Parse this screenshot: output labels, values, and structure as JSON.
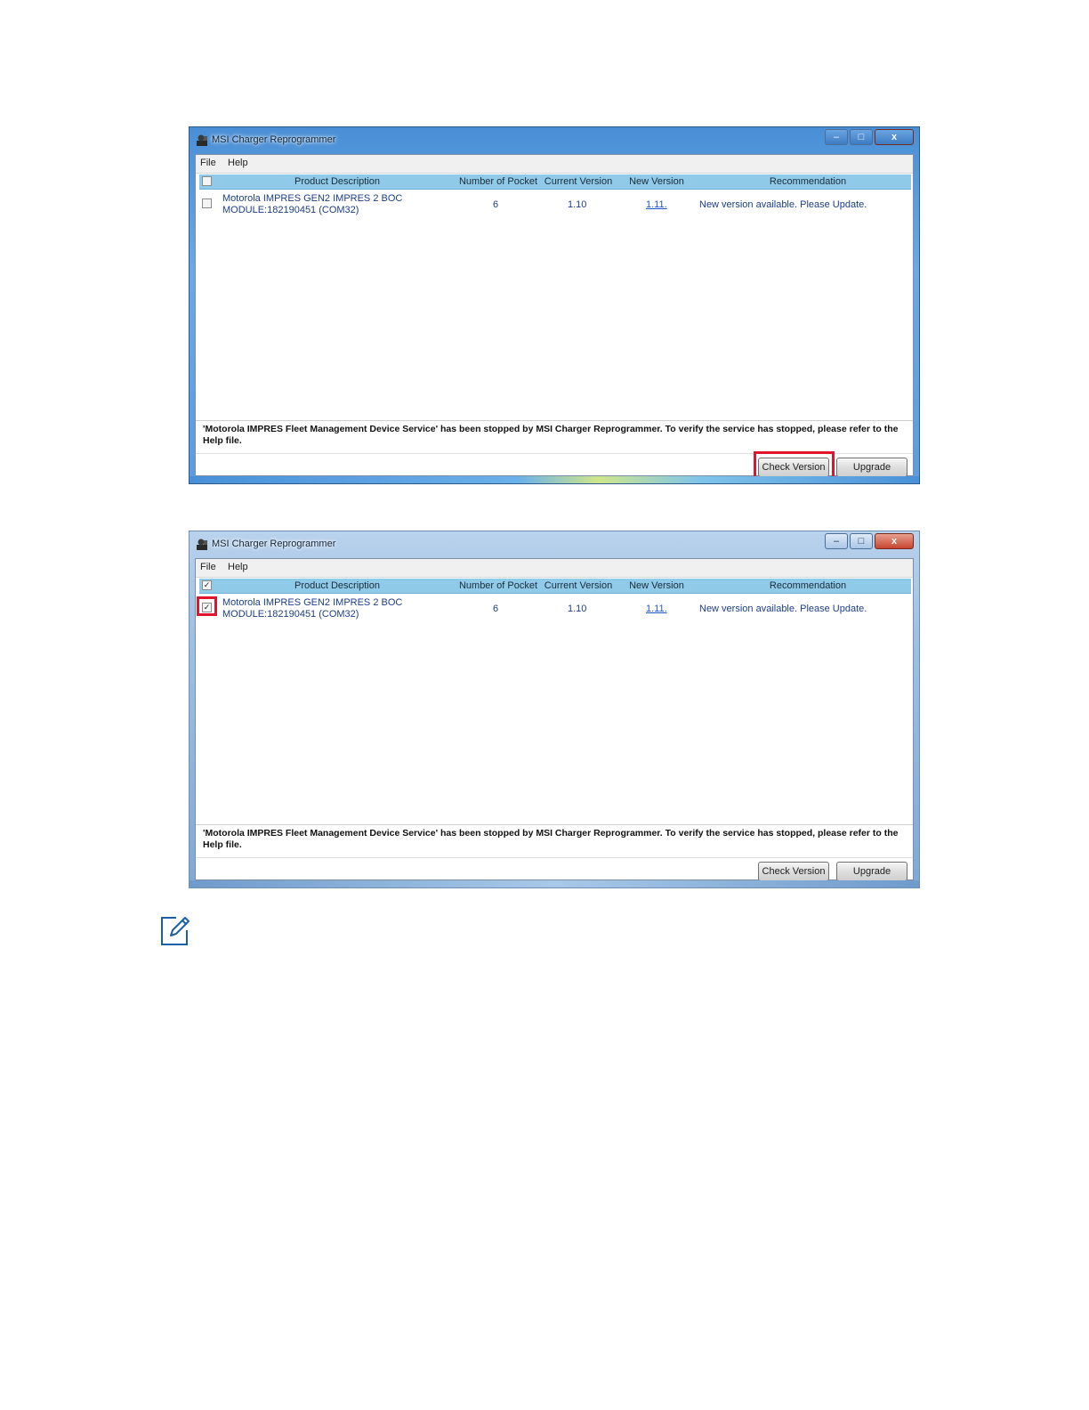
{
  "windows": [
    {
      "title": "MSI Charger Reprogrammer",
      "controls": {
        "minimize": "–",
        "maximize": "□",
        "close": "x"
      },
      "menu": [
        "File",
        "Help"
      ],
      "columns": [
        "Product Description",
        "Number of Pocket",
        "Current Version",
        "New Version",
        "Recommendation"
      ],
      "header_checked": false,
      "row": {
        "checked": false,
        "checkmark": "",
        "description_line1": "Motorola IMPRES GEN2 IMPRES 2 BOC",
        "description_line2": "MODULE:182190451 (COM32)",
        "pockets": "6",
        "current_version": "1.10",
        "new_version": "1.11.",
        "recommendation": "New version available. Please Update."
      },
      "message": "'Motorola IMPRES Fleet Management Device Service' has been stopped by MSI Charger Reprogrammer. To verify the service has stopped, please refer to the Help file.",
      "buttons": {
        "check_version": "Check Version",
        "upgrade": "Upgrade"
      },
      "highlight": "check-version-button"
    },
    {
      "title": "MSI Charger Reprogrammer",
      "controls": {
        "minimize": "–",
        "maximize": "□",
        "close": "x"
      },
      "menu": [
        "File",
        "Help"
      ],
      "columns": [
        "Product Description",
        "Number of Pocket",
        "Current Version",
        "New Version",
        "Recommendation"
      ],
      "header_checked": true,
      "header_checkmark": "✓",
      "row": {
        "checked": true,
        "checkmark": "✓",
        "description_line1": "Motorola IMPRES GEN2 IMPRES 2 BOC",
        "description_line2": "MODULE:182190451 (COM32)",
        "pockets": "6",
        "current_version": "1.10",
        "new_version": "1.11.",
        "recommendation": "New version available. Please Update."
      },
      "message": "'Motorola IMPRES Fleet Management Device Service' has been stopped by MSI Charger Reprogrammer. To verify the service has stopped, please refer to the Help file.",
      "buttons": {
        "check_version": "Check Version",
        "upgrade": "Upgrade"
      },
      "highlight": "row-checkbox"
    }
  ],
  "note_icon": "note-pencil-icon",
  "colors": {
    "highlight": "#e0152d",
    "grid_header": "#8fcbe8",
    "link": "#1f55c8"
  }
}
